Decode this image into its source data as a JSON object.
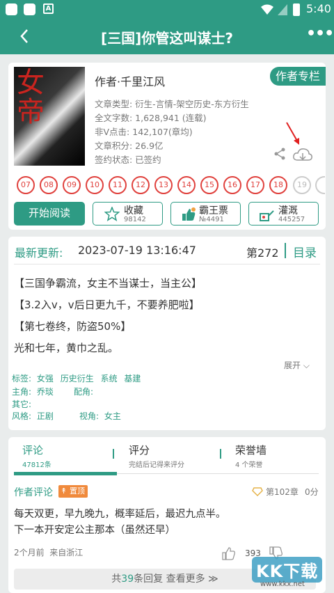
{
  "status": {
    "time": "5:40"
  },
  "nav": {
    "title": "[三国]你管这叫谋士?"
  },
  "book": {
    "author": "作者·千里江风",
    "author_column": "作者专栏",
    "type": "文章类型: 衍生-言情-架空历史-东方衍生",
    "words": "全文字数: 1,628,941 (连载)",
    "clicks": "非V点击: 142,107(章均)",
    "score": "文章积分: 26.9亿",
    "contract": "签约状态: 已签约",
    "cover_glyphs": "女帝"
  },
  "flowers": [
    "07",
    "08",
    "09",
    "10",
    "11",
    "12",
    "13",
    "14",
    "15",
    "16",
    "17",
    "18",
    "19"
  ],
  "actions": {
    "read": "开始阅读",
    "fav": "收藏",
    "fav_count": "98142",
    "ticket": "霸王票",
    "ticket_count": "№4491",
    "water": "灌溉",
    "water_count": "445257"
  },
  "update": {
    "label": "最新更新:",
    "date": "2023-07-19 13:16:47",
    "chapter": "第272",
    "toc": "目录",
    "lines": [
      "【三国争霸流，女主不当谋士，当主公】",
      "【3.2入v，v后日更九千，不要养肥啦】",
      "【第七卷终，防盗50%】",
      "光和七年，黄巾之乱。"
    ],
    "expand": "展开"
  },
  "meta": {
    "tags_label": "标签:",
    "tags": [
      "女强",
      "历史衍生",
      "系统",
      "基建"
    ],
    "lead_label": "主角:",
    "lead": "乔琰",
    "support_label": "配角:",
    "other_label": "其它:",
    "style_label": "风格:",
    "style": "正剧",
    "view_label": "视角:",
    "view": "女主"
  },
  "tabs": [
    {
      "label": "评论",
      "sub": "47812条"
    },
    {
      "label": "评分",
      "sub": "完结后记得来评分"
    },
    {
      "label": "荣誉墙",
      "sub": "4 个荣誉"
    }
  ],
  "comment": {
    "title": "作者评论",
    "pin": "置顶",
    "chapter": "第102章",
    "score": "0分",
    "lines": [
      "每天双更，早九晚九，概率延后，最迟九点半。",
      "下一本开安定公主那本（虽然还早）"
    ],
    "time": "2个月前  来自浙江",
    "likes": "393",
    "replies_pre": "共",
    "replies_num": "39",
    "replies_post": "条回复 查看更多"
  },
  "watermark": {
    "main": "KK下载",
    "sub": "www.kkx.net"
  },
  "colors": {
    "accent": "#2e9b84",
    "flower": "#e0413d",
    "pin": "#f08a3c"
  }
}
